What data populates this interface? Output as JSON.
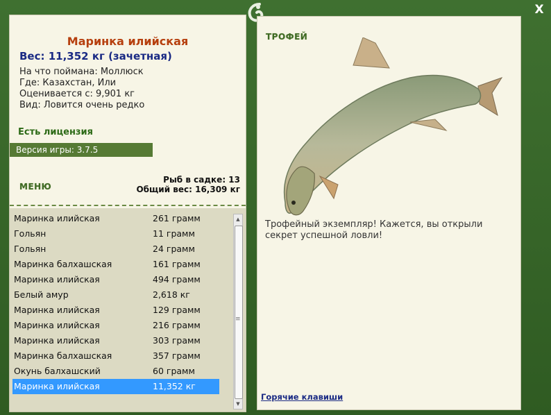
{
  "window": {
    "close_label": "X"
  },
  "catch": {
    "name": "Маринка илийская",
    "weight": "Вес: 11,352 кг (зачетная)",
    "bait": "На что поймана: Моллюск",
    "location": "Где: Казахстан, Или",
    "valued": "Оценивается с: 9,901 кг",
    "rarity": "Вид: Ловится очень редко"
  },
  "license": "Есть лицензия",
  "version": "Версия игры: 3.7.5",
  "menu_label": "МЕНЮ",
  "net": {
    "count": "Рыб в садке: 13",
    "total": "Общий вес: 16,309 кг"
  },
  "fish_list": [
    {
      "name": "Маринка илийская",
      "weight": "261 грамм"
    },
    {
      "name": "Гольян",
      "weight": "11 грамм"
    },
    {
      "name": "Гольян",
      "weight": "24 грамм"
    },
    {
      "name": "Маринка балхашская",
      "weight": "161 грамм"
    },
    {
      "name": "Маринка илийская",
      "weight": "494 грамм"
    },
    {
      "name": "Белый амур",
      "weight": "2,618 кг"
    },
    {
      "name": "Маринка илийская",
      "weight": "129 грамм"
    },
    {
      "name": "Маринка илийская",
      "weight": "216 грамм"
    },
    {
      "name": "Маринка илийская",
      "weight": "303 грамм"
    },
    {
      "name": "Маринка балхашская",
      "weight": "357 грамм"
    },
    {
      "name": "Окунь балхашский",
      "weight": "60 грамм"
    },
    {
      "name": "Маринка илийская",
      "weight": "11,352 кг",
      "selected": true
    }
  ],
  "trophy_label": "ТРОФЕЙ",
  "trophy_text": "Трофейный экземпляр! Кажется, вы открыли секрет успешной ловли!",
  "hotkeys_label": "Горячие клавиши",
  "colors": {
    "title": "#b63f0e",
    "weight": "#1a2a84",
    "selection": "#3399ff",
    "frame": "#3f7030"
  }
}
